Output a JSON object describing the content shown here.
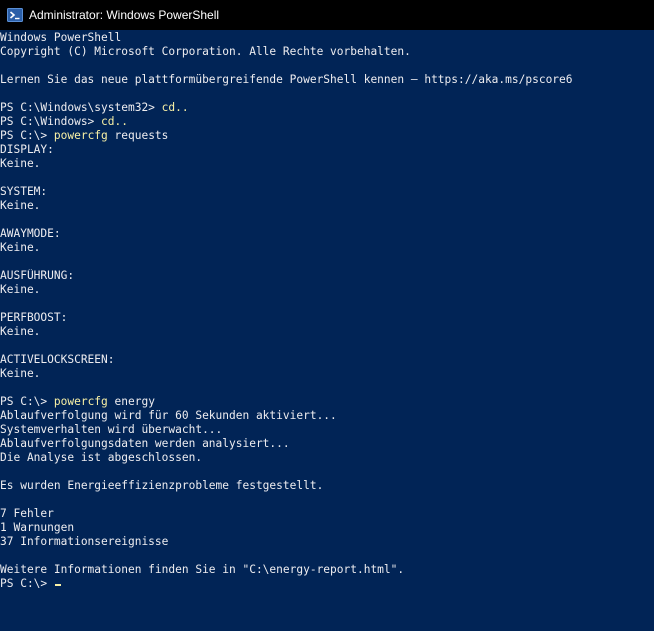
{
  "window": {
    "title": "Administrator: Windows PowerShell",
    "icon": "powershell-icon"
  },
  "colors": {
    "background": "#012456",
    "text": "#eeedf0",
    "command": "#f9f1a5",
    "titlebar": "#000000"
  },
  "console": {
    "lines": [
      {
        "text": "Windows PowerShell"
      },
      {
        "text": "Copyright (C) Microsoft Corporation. Alle Rechte vorbehalten."
      },
      {
        "text": ""
      },
      {
        "text": "Lernen Sie das neue plattformübergreifende PowerShell kennen – https://aka.ms/pscore6"
      },
      {
        "text": ""
      },
      {
        "prompt": "PS C:\\Windows\\system32> ",
        "cmd": "cd..",
        "args": ""
      },
      {
        "prompt": "PS C:\\Windows> ",
        "cmd": "cd..",
        "args": ""
      },
      {
        "prompt": "PS C:\\> ",
        "cmd": "powercfg",
        "args": " requests"
      },
      {
        "text": "DISPLAY:"
      },
      {
        "text": "Keine."
      },
      {
        "text": ""
      },
      {
        "text": "SYSTEM:"
      },
      {
        "text": "Keine."
      },
      {
        "text": ""
      },
      {
        "text": "AWAYMODE:"
      },
      {
        "text": "Keine."
      },
      {
        "text": ""
      },
      {
        "text": "AUSFÜHRUNG:"
      },
      {
        "text": "Keine."
      },
      {
        "text": ""
      },
      {
        "text": "PERFBOOST:"
      },
      {
        "text": "Keine."
      },
      {
        "text": ""
      },
      {
        "text": "ACTIVELOCKSCREEN:"
      },
      {
        "text": "Keine."
      },
      {
        "text": ""
      },
      {
        "prompt": "PS C:\\> ",
        "cmd": "powercfg",
        "args": " energy"
      },
      {
        "text": "Ablaufverfolgung wird für 60 Sekunden aktiviert..."
      },
      {
        "text": "Systemverhalten wird überwacht..."
      },
      {
        "text": "Ablaufverfolgungsdaten werden analysiert..."
      },
      {
        "text": "Die Analyse ist abgeschlossen."
      },
      {
        "text": ""
      },
      {
        "text": "Es wurden Energieeffizienzprobleme festgestellt."
      },
      {
        "text": ""
      },
      {
        "text": "7 Fehler"
      },
      {
        "text": "1 Warnungen"
      },
      {
        "text": "37 Informationsereignisse"
      },
      {
        "text": ""
      },
      {
        "text": "Weitere Informationen finden Sie in \"C:\\energy-report.html\"."
      },
      {
        "prompt": "PS C:\\> ",
        "cmd": "",
        "args": "",
        "cursor": true
      }
    ]
  }
}
